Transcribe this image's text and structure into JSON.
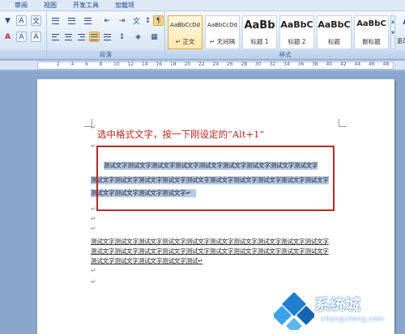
{
  "ribbon_tabs": [
    "审阅",
    "视图",
    "开发工具",
    "加载项"
  ],
  "groups": {
    "paragraph_label": "段落",
    "styles_label": "样式"
  },
  "styles": [
    {
      "sample": "AaBbCcDd",
      "name": "↵ 正文"
    },
    {
      "sample": "AaBbCcDd",
      "name": "↵ 无间隔"
    },
    {
      "sample": "AaBb",
      "name": "标题 1"
    },
    {
      "sample": "AaBbC",
      "name": "标题 2"
    },
    {
      "sample": "AaBbC",
      "name": "标题"
    },
    {
      "sample": "AaBbC",
      "name": "副标题"
    }
  ],
  "change_styles_label": "更改样式",
  "ruler_numbers": [
    "2",
    "4",
    "6",
    "8",
    "10",
    "12",
    "14",
    "16",
    "18",
    "20",
    "22",
    "24",
    "26",
    "28",
    "30",
    "32",
    "34",
    "36",
    "38",
    "40",
    "42",
    "44",
    "46",
    "48"
  ],
  "document": {
    "title": "选中格式文字，按一下刚设定的“Alt+1”",
    "para1": [
      "测试文字测试文字测试文字测试文字测试文字测试文字测试文字测试文字测试文字",
      "测试文字测试文字测试文字测试文字测试文字测试文字测试文字测试文字测试文字测试文字",
      "测试文字测试文字测试文字测试文字↵"
    ],
    "para2": [
      "测试文字测试文字测试文字测试文字测试文字测试文字测试文字测试文字测试文字测试文字",
      "测试文字测试文字测试文字测试文字测试文字测试文字测试文字测试文字测试文字测试文字",
      "测试文字测试文字测试文字测试文字测试↵"
    ],
    "para_mark": "↵"
  },
  "watermark": {
    "name": "系统城",
    "url": "xitongcheng.com"
  },
  "colors": {
    "title": "#b5271e",
    "highlight": "#b7c9e6",
    "callout": "#b52a2a"
  }
}
